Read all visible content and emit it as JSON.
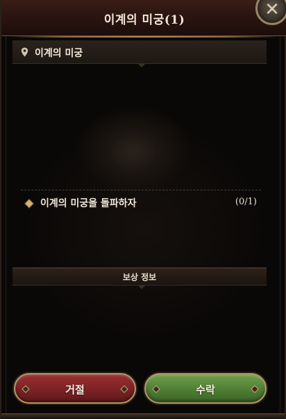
{
  "header": {
    "title": "이계의 미궁(1)",
    "close_icon": "close-icon"
  },
  "location": {
    "icon": "map-pin-icon",
    "text": "이계의 미궁"
  },
  "objective": {
    "icon": "diamond-bullet-icon",
    "text": "이계의 미궁을 돌파하자",
    "progress": "(0/1)"
  },
  "reward": {
    "label": "보상 정보"
  },
  "buttons": {
    "decline_label": "거절",
    "accept_label": "수락"
  },
  "colors": {
    "decline": "#7b2224",
    "accept": "#4f7e34",
    "accent_gold": "#b49a6a"
  }
}
